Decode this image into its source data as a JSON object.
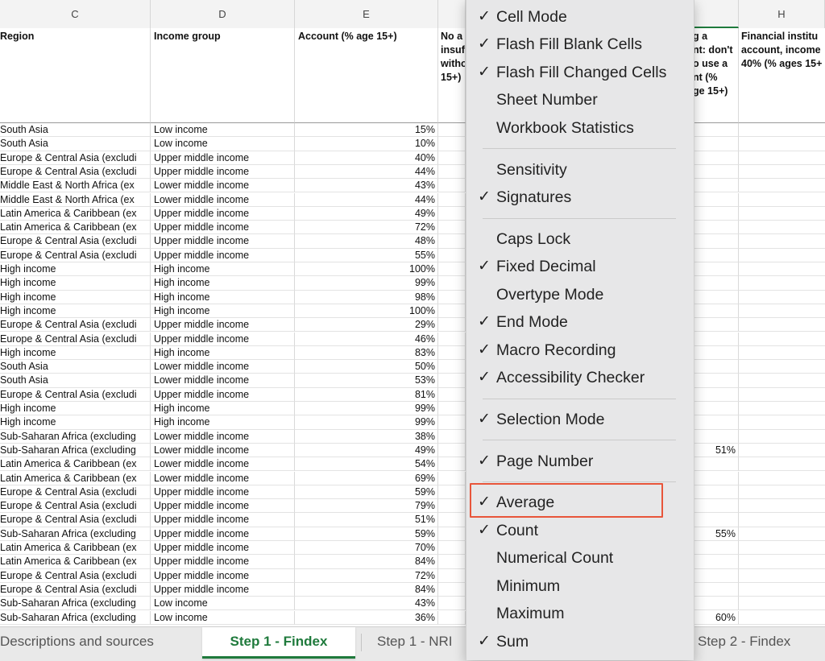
{
  "columns": [
    "C",
    "D",
    "E",
    "",
    "",
    "H"
  ],
  "headers": {
    "region": "Region",
    "income_group": "Income group",
    "account": "Account (% age 15+)",
    "no_account_partial": "No a\ninsuf\nwitho\n15+)",
    "right_partial": "g a\nnt: don't\no use a\nnt (%\nge 15+)",
    "financial_institution": "Financial institu\naccount, income\n40% (% ages 15+"
  },
  "rows": [
    {
      "region": "South Asia",
      "income": "Low income",
      "account": "15%",
      "g": ""
    },
    {
      "region": "South Asia",
      "income": "Low income",
      "account": "10%",
      "g": ""
    },
    {
      "region": "Europe & Central Asia (excludi",
      "income": "Upper middle income",
      "account": "40%",
      "g": ""
    },
    {
      "region": "Europe & Central Asia (excludi",
      "income": "Upper middle income",
      "account": "44%",
      "g": ""
    },
    {
      "region": "Middle East & North Africa (ex",
      "income": "Lower middle income",
      "account": "43%",
      "g": ""
    },
    {
      "region": "Middle East & North Africa (ex",
      "income": "Lower middle income",
      "account": "44%",
      "g": ""
    },
    {
      "region": "Latin America & Caribbean (ex",
      "income": "Upper middle income",
      "account": "49%",
      "g": ""
    },
    {
      "region": "Latin America & Caribbean (ex",
      "income": "Upper middle income",
      "account": "72%",
      "g": ""
    },
    {
      "region": "Europe & Central Asia (excludi",
      "income": "Upper middle income",
      "account": "48%",
      "g": ""
    },
    {
      "region": "Europe & Central Asia (excludi",
      "income": "Upper middle income",
      "account": "55%",
      "g": ""
    },
    {
      "region": "High income",
      "income": "High income",
      "account": "100%",
      "g": ""
    },
    {
      "region": "High income",
      "income": "High income",
      "account": "99%",
      "g": ""
    },
    {
      "region": "High income",
      "income": "High income",
      "account": "98%",
      "g": ""
    },
    {
      "region": "High income",
      "income": "High income",
      "account": "100%",
      "g": ""
    },
    {
      "region": "Europe & Central Asia (excludi",
      "income": "Upper middle income",
      "account": "29%",
      "g": ""
    },
    {
      "region": "Europe & Central Asia (excludi",
      "income": "Upper middle income",
      "account": "46%",
      "g": ""
    },
    {
      "region": "High income",
      "income": "High income",
      "account": "83%",
      "g": ""
    },
    {
      "region": "South Asia",
      "income": "Lower middle income",
      "account": "50%",
      "g": ""
    },
    {
      "region": "South Asia",
      "income": "Lower middle income",
      "account": "53%",
      "g": ""
    },
    {
      "region": "Europe & Central Asia (excludi",
      "income": "Upper middle income",
      "account": "81%",
      "g": ""
    },
    {
      "region": "High income",
      "income": "High income",
      "account": "99%",
      "g": ""
    },
    {
      "region": "High income",
      "income": "High income",
      "account": "99%",
      "g": ""
    },
    {
      "region": "Sub-Saharan Africa (excluding",
      "income": "Lower middle income",
      "account": "38%",
      "g": ""
    },
    {
      "region": "Sub-Saharan Africa (excluding",
      "income": "Lower middle income",
      "account": "49%",
      "g": "51%"
    },
    {
      "region": "Latin America & Caribbean (ex",
      "income": "Lower middle income",
      "account": "54%",
      "g": ""
    },
    {
      "region": "Latin America & Caribbean (ex",
      "income": "Lower middle income",
      "account": "69%",
      "g": ""
    },
    {
      "region": "Europe & Central Asia (excludi",
      "income": "Upper middle income",
      "account": "59%",
      "g": ""
    },
    {
      "region": "Europe & Central Asia (excludi",
      "income": "Upper middle income",
      "account": "79%",
      "g": ""
    },
    {
      "region": "Europe & Central Asia (excludi",
      "income": "Upper middle income",
      "account": "51%",
      "g": ""
    },
    {
      "region": "Sub-Saharan Africa (excluding",
      "income": "Upper middle income",
      "account": "59%",
      "g": "55%"
    },
    {
      "region": "Latin America & Caribbean (ex",
      "income": "Upper middle income",
      "account": "70%",
      "g": ""
    },
    {
      "region": "Latin America & Caribbean (ex",
      "income": "Upper middle income",
      "account": "84%",
      "g": ""
    },
    {
      "region": "Europe & Central Asia (excludi",
      "income": "Upper middle income",
      "account": "72%",
      "g": ""
    },
    {
      "region": "Europe & Central Asia (excludi",
      "income": "Upper middle income",
      "account": "84%",
      "g": ""
    },
    {
      "region": "Sub-Saharan Africa (excluding",
      "income": "Low income",
      "account": "43%",
      "g": ""
    },
    {
      "region": "Sub-Saharan Africa (excluding",
      "income": "Low income",
      "account": "36%",
      "g": "60%"
    }
  ],
  "tabs": [
    "Descriptions and sources",
    "Step 1 - Findex",
    "Step 1 - NRI",
    "Step 2 - Findex"
  ],
  "active_tab": "Step 1 - Findex",
  "menu": {
    "checkmark_glyph": "✓",
    "items": [
      {
        "label": "Cell Mode",
        "checked": true
      },
      {
        "label": "Flash Fill Blank Cells",
        "checked": true
      },
      {
        "label": "Flash Fill Changed Cells",
        "checked": true
      },
      {
        "label": "Sheet Number",
        "checked": false
      },
      {
        "label": "Workbook Statistics",
        "checked": false
      },
      {
        "separator": true
      },
      {
        "label": "Sensitivity",
        "checked": false
      },
      {
        "label": "Signatures",
        "checked": true
      },
      {
        "separator": true
      },
      {
        "label": "Caps Lock",
        "checked": false
      },
      {
        "label": "Fixed Decimal",
        "checked": true
      },
      {
        "label": "Overtype Mode",
        "checked": false
      },
      {
        "label": "End Mode",
        "checked": true
      },
      {
        "label": "Macro Recording",
        "checked": true
      },
      {
        "label": "Accessibility Checker",
        "checked": true
      },
      {
        "separator": true
      },
      {
        "label": "Selection Mode",
        "checked": true
      },
      {
        "separator": true
      },
      {
        "label": "Page Number",
        "checked": true
      },
      {
        "separator": true
      },
      {
        "label": "Average",
        "checked": true,
        "highlighted": true
      },
      {
        "label": "Count",
        "checked": true
      },
      {
        "label": "Numerical Count",
        "checked": false
      },
      {
        "label": "Minimum",
        "checked": false
      },
      {
        "label": "Maximum",
        "checked": false
      },
      {
        "label": "Sum",
        "checked": true
      }
    ]
  },
  "colors": {
    "accent": "#1f7a3c",
    "highlight": "#e8553a",
    "menu_bg": "#e7e7e8"
  }
}
